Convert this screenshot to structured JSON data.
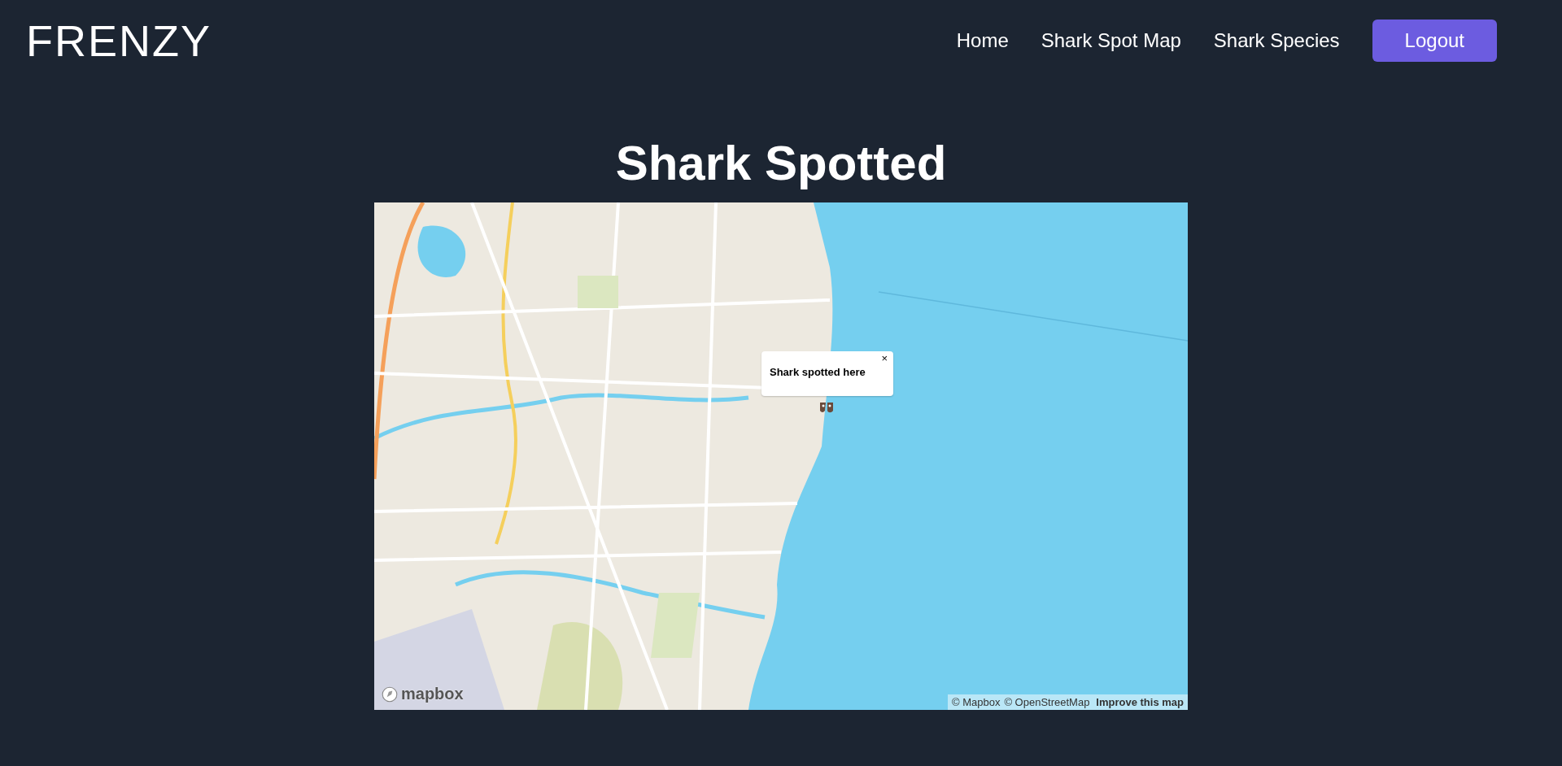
{
  "brand": "FRENZY",
  "nav": [
    {
      "label": "Home",
      "kind": "link"
    },
    {
      "label": "Shark Spot Map",
      "kind": "link"
    },
    {
      "label": "Shark Species",
      "kind": "link"
    },
    {
      "label": "Logout",
      "kind": "button"
    }
  ],
  "heading": "Shark Spotted",
  "map": {
    "popup": {
      "text": "Shark spotted here",
      "close": "×"
    },
    "logo": "mapbox",
    "attribution": [
      "© Mapbox",
      "© OpenStreetMap"
    ],
    "improve_link": "Improve this map"
  }
}
